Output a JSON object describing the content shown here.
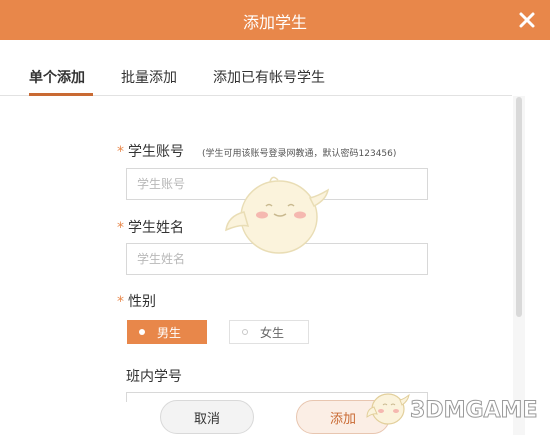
{
  "dialog": {
    "title": "添加学生",
    "close_icon": "close-icon"
  },
  "tabs": [
    {
      "label": "单个添加",
      "active": true
    },
    {
      "label": "批量添加",
      "active": false
    },
    {
      "label": "添加已有帐号学生",
      "active": false
    }
  ],
  "form": {
    "account": {
      "required_mark": "*",
      "label": "学生账号",
      "hint": "(学生可用该账号登录网教通，默认密码123456)",
      "placeholder": "学生账号",
      "value": ""
    },
    "name": {
      "required_mark": "*",
      "label": "学生姓名",
      "placeholder": "学生姓名",
      "value": ""
    },
    "gender": {
      "required_mark": "*",
      "label": "性别",
      "options": [
        {
          "label": "男生",
          "selected": true
        },
        {
          "label": "女生",
          "selected": false
        }
      ]
    },
    "class_number": {
      "label": "班内学号"
    }
  },
  "buttons": {
    "cancel": "取消",
    "confirm": "添加"
  },
  "watermark": {
    "text": "3DMGAME"
  },
  "colors": {
    "accent": "#e8874a",
    "accent_dark": "#c96a33",
    "border": "#d8d8d8"
  }
}
